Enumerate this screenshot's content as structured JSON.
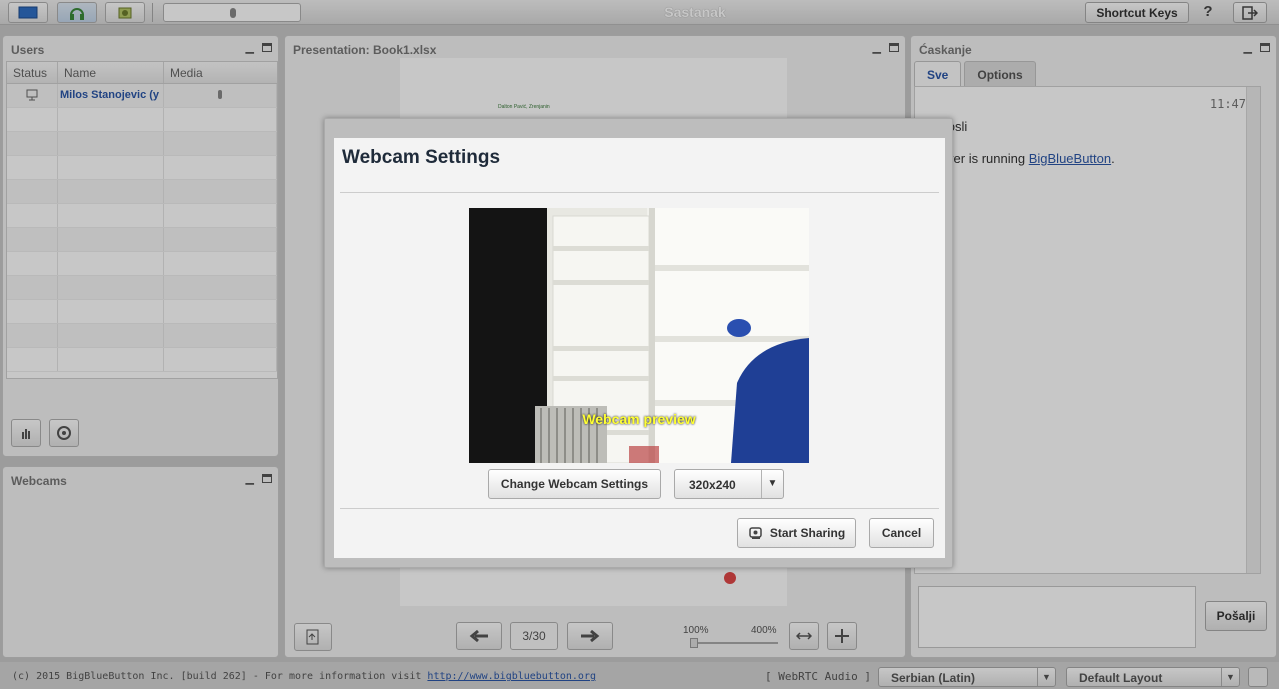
{
  "topbar": {
    "title": "Sastanak",
    "shortcut_label": "Shortcut Keys",
    "help_label": "?"
  },
  "users": {
    "title": "Users",
    "columns": [
      "Status",
      "Name",
      "Media"
    ],
    "rows": [
      {
        "name": "Milos Stanojevic (y"
      }
    ]
  },
  "webcams": {
    "title": "Webcams"
  },
  "presentation": {
    "title": "Presentation: Book1.xlsx",
    "slide_text": "Dalton Pavić, Zrenjanin",
    "page": "3/30",
    "zoom_min": "100%",
    "zoom_max": "400%"
  },
  "chat": {
    "title": "Ćaskanje",
    "tabs": [
      "Sve",
      "Options"
    ],
    "time": "11:47",
    "line1": "rodosli",
    "line2_prefix": "server is running ",
    "line2_link": "BigBlueButton",
    "line2_suffix": ".",
    "send_label": "Pošalji"
  },
  "footer": {
    "copyright": "(c) 2015 BigBlueButton Inc. [build 262] - For more information visit ",
    "link": "http://www.bigbluebutton.org",
    "audio": "[ WebRTC Audio ]",
    "language": "Serbian (Latin)",
    "layout": "Default Layout"
  },
  "modal": {
    "title": "Webcam Settings",
    "preview_label": "Webcam preview",
    "change_label": "Change Webcam Settings",
    "resolution": "320x240",
    "start_label": "Start Sharing",
    "cancel_label": "Cancel"
  },
  "colors": {
    "accent": "#2b57a8",
    "preview_label": "#ffff33",
    "slide_dot": "#e04848"
  }
}
